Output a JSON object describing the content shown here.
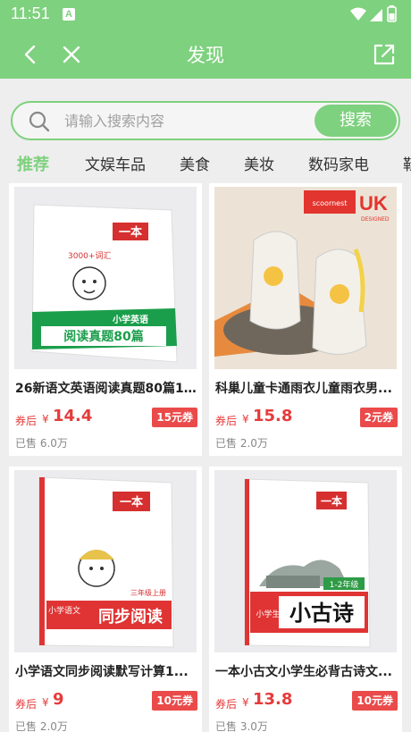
{
  "status": {
    "time": "11:51",
    "a_badge": "A"
  },
  "nav": {
    "title": "发现"
  },
  "search": {
    "placeholder": "请输入搜索内容",
    "button_label": "搜索"
  },
  "tabs": [
    "推荐",
    "文娱车品",
    "美食",
    "美妆",
    "数码家电",
    "鞋"
  ],
  "products": [
    {
      "title": "26新语文英语阅读真题80篇1...",
      "price_prefix": "券后",
      "currency": "¥",
      "price": "14.4",
      "coupon": "15元券",
      "sold": "已售 6.0万",
      "image_text": {
        "brand": "一本",
        "subtitle": "小学英语",
        "main": "阅读真题80篇",
        "count": "3000+词汇"
      }
    },
    {
      "title": "科巢儿童卡通雨衣儿童雨衣男...",
      "price_prefix": "券后",
      "currency": "¥",
      "price": "15.8",
      "coupon": "2元券",
      "sold": "已售 2.0万",
      "image_text": {
        "brand": "scoornest",
        "mark": "UK",
        "designed": "DESIGNED"
      }
    },
    {
      "title": "小学语文同步阅读默写计算1...",
      "price_prefix": "券后",
      "currency": "¥",
      "price": "9",
      "coupon": "10元券",
      "sold": "已售 2.0万",
      "image_text": {
        "brand": "一本",
        "subject": "小学语文",
        "main": "同步阅读",
        "grade": "三年级上册"
      }
    },
    {
      "title": "一本小古文小学生必背古诗文...",
      "price_prefix": "券后",
      "currency": "¥",
      "price": "13.8",
      "coupon": "10元券",
      "sold": "已售 3.0万",
      "image_text": {
        "brand": "一本",
        "level": "1-2年级",
        "prefix": "小学生",
        "main": "小古诗"
      }
    }
  ],
  "colors": {
    "primary": "#7ed17e",
    "price": "#e63b3b",
    "coupon": "#ea4a4a",
    "background": "#eeeeee"
  }
}
